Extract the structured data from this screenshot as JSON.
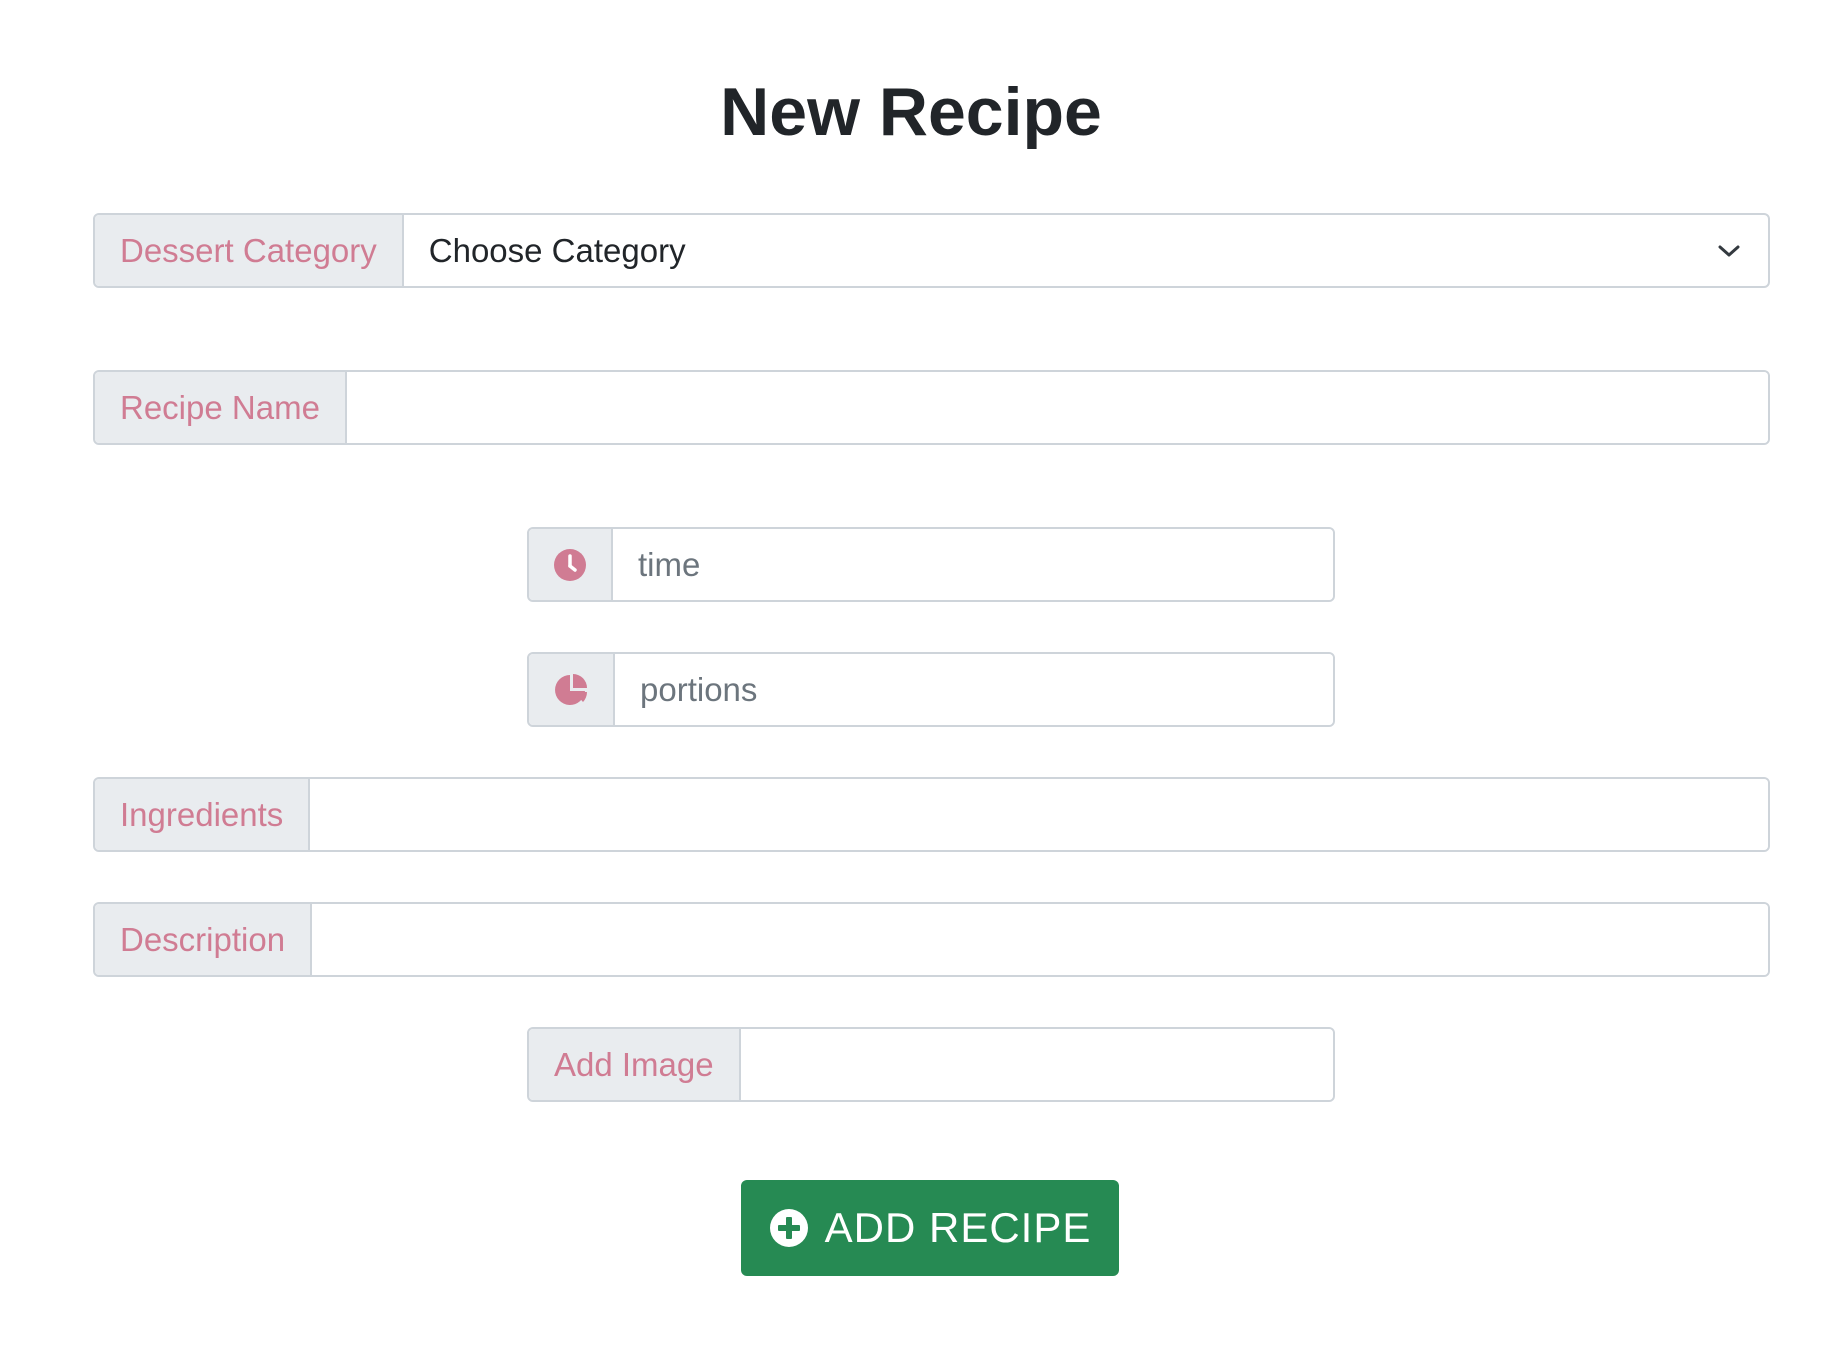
{
  "page": {
    "title": "New Recipe"
  },
  "form": {
    "category": {
      "label": "Dessert Category",
      "selected": "Choose Category"
    },
    "recipe_name": {
      "label": "Recipe Name",
      "value": "",
      "placeholder": ""
    },
    "time": {
      "icon": "clock-icon",
      "value": "",
      "placeholder": "time"
    },
    "portions": {
      "icon": "pie-chart-icon",
      "value": "",
      "placeholder": "portions"
    },
    "ingredients": {
      "label": "Ingredients",
      "value": "",
      "placeholder": ""
    },
    "description": {
      "label": "Description",
      "value": "",
      "placeholder": ""
    },
    "image": {
      "label": "Add Image",
      "value": "",
      "placeholder": ""
    },
    "submit": {
      "label": "ADD RECIPE",
      "icon": "plus-circle-icon"
    }
  },
  "colors": {
    "label_text": "#d07c93",
    "addon_background": "#e9ecef",
    "border": "#ced4da",
    "button": "#268a53",
    "title": "#212529"
  }
}
